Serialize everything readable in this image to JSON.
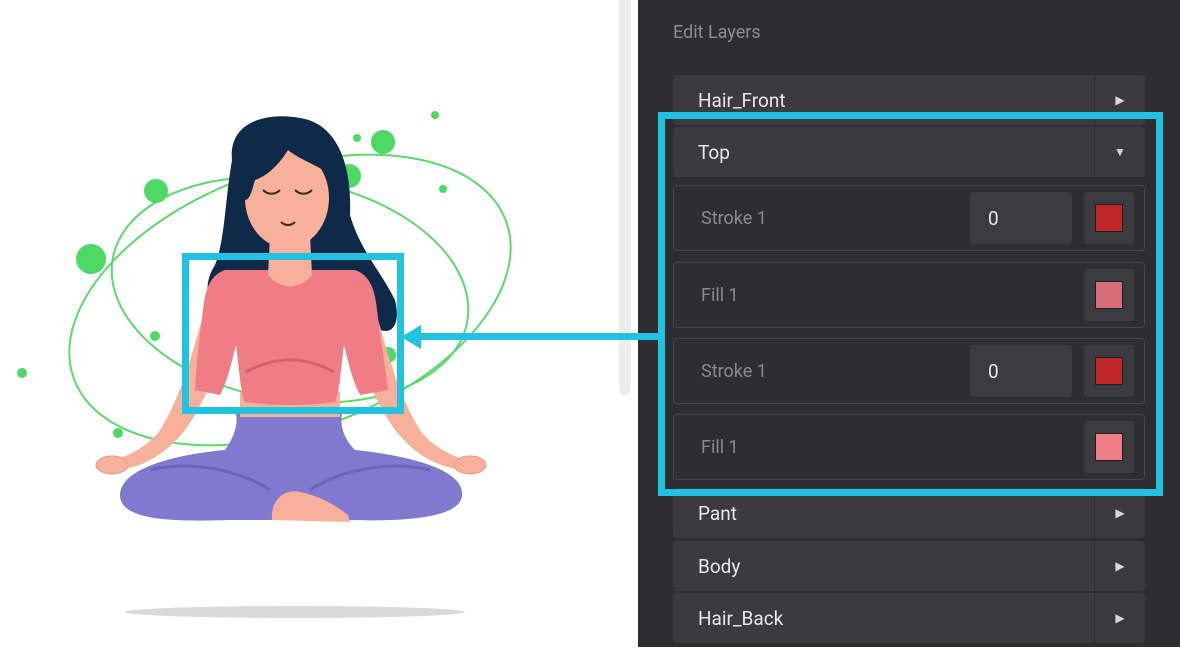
{
  "panel": {
    "title": "Edit Layers",
    "layers_top": [
      {
        "label": "Hair_Front",
        "state": "collapsed"
      },
      {
        "label": "Top",
        "state": "expanded"
      }
    ],
    "top_properties": [
      {
        "label": "Stroke 1",
        "value": "0",
        "color": "#c0272a"
      },
      {
        "label": "Fill 1",
        "color": "#d66d78"
      },
      {
        "label": "Stroke 1",
        "value": "0",
        "color": "#c0272a"
      },
      {
        "label": "Fill 1",
        "color": "#f07c86"
      }
    ],
    "layers_bottom": [
      {
        "label": "Pant",
        "state": "collapsed"
      },
      {
        "label": "Body",
        "state": "collapsed"
      },
      {
        "label": "Hair_Back",
        "state": "collapsed"
      }
    ]
  },
  "illustration": {
    "subject": "woman meditating in lotus pose",
    "colors": {
      "hair": "#0f2a48",
      "skin": "#f7b09a",
      "top": "#f07c86",
      "pants": "#8178d0",
      "circles": "#4cd964"
    }
  },
  "highlight": {
    "color": "#22c3e0"
  }
}
